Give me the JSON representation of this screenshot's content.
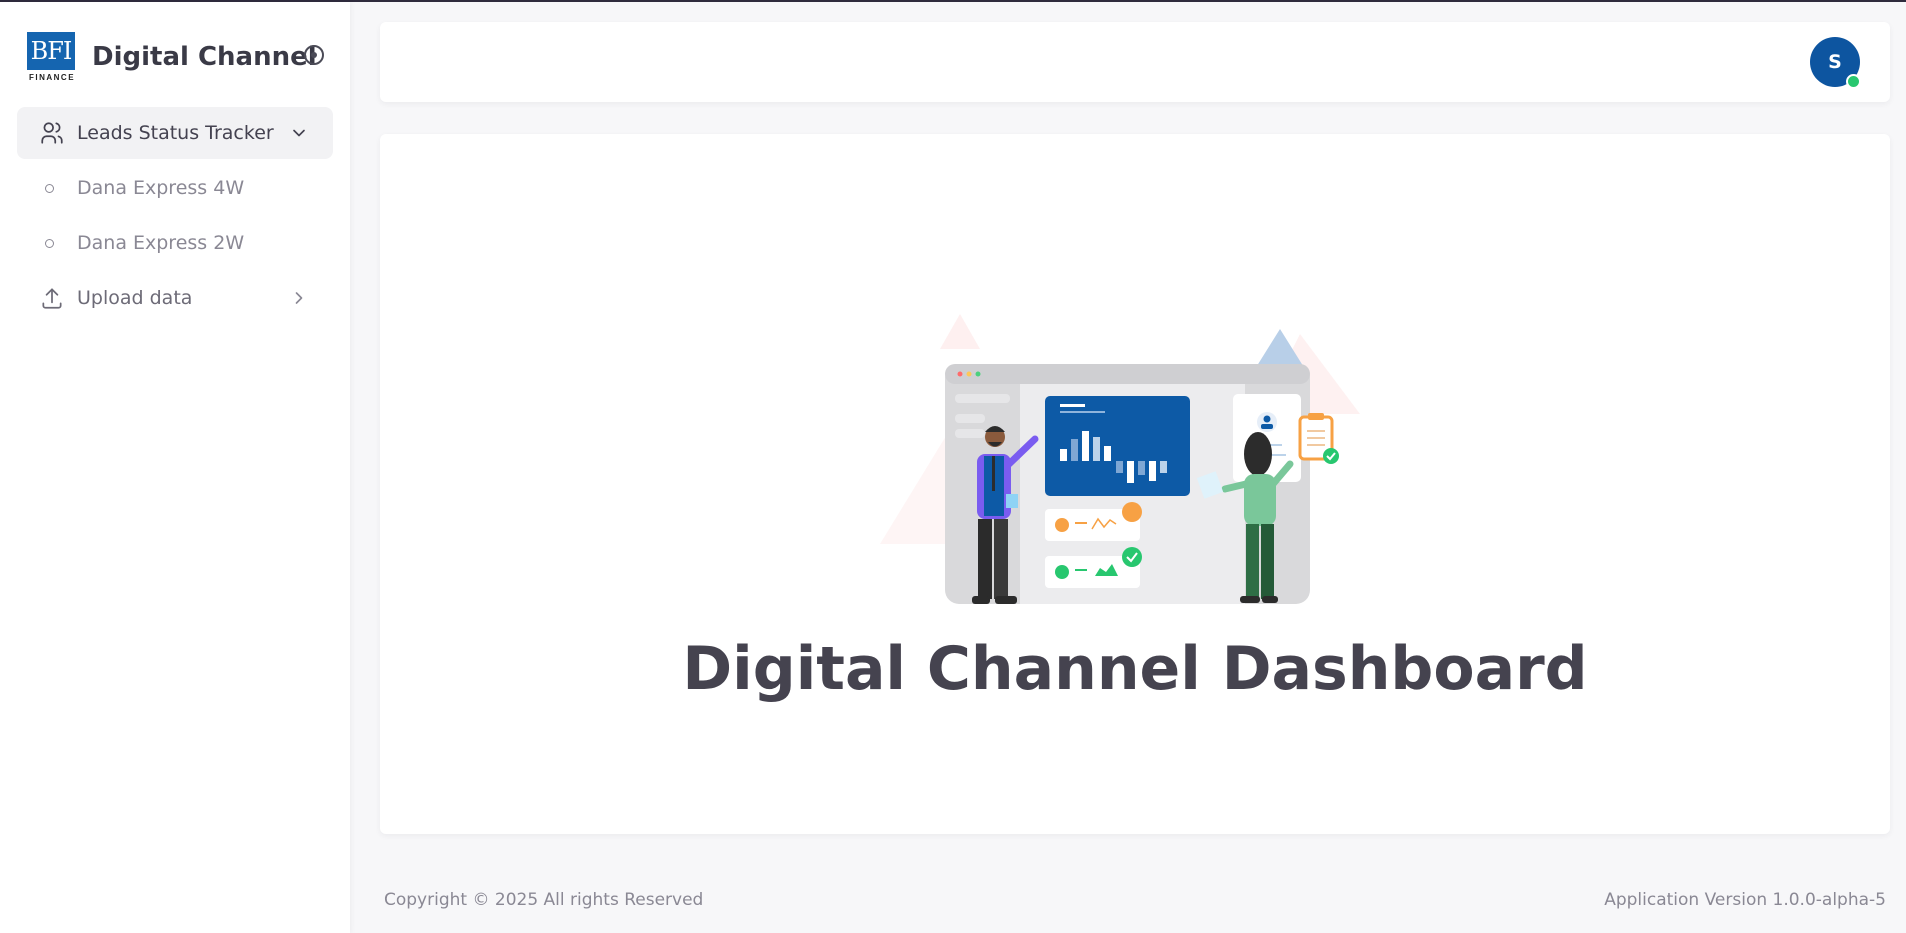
{
  "brand": {
    "logo_text": "BFI",
    "logo_subtext": "FINANCE",
    "title": "Digital Channel"
  },
  "sidebar": {
    "items": [
      {
        "label": "Leads Status Tracker",
        "icon": "users-icon",
        "expanded": true
      },
      {
        "label": "Dana Express 4W"
      },
      {
        "label": "Dana Express 2W"
      },
      {
        "label": "Upload data",
        "icon": "upload-icon",
        "expanded": false
      }
    ]
  },
  "header": {
    "avatar_initial": "S",
    "status_color": "#28c76f"
  },
  "main": {
    "headline": "Digital Channel Dashboard"
  },
  "footer": {
    "copyright": "Copyright © 2025 All rights Reserved",
    "version": "Application Version 1.0.0-alpha-5"
  },
  "colors": {
    "primary": "#0d55a0",
    "text_dark": "#45434f",
    "background": "#f7f7f9"
  }
}
